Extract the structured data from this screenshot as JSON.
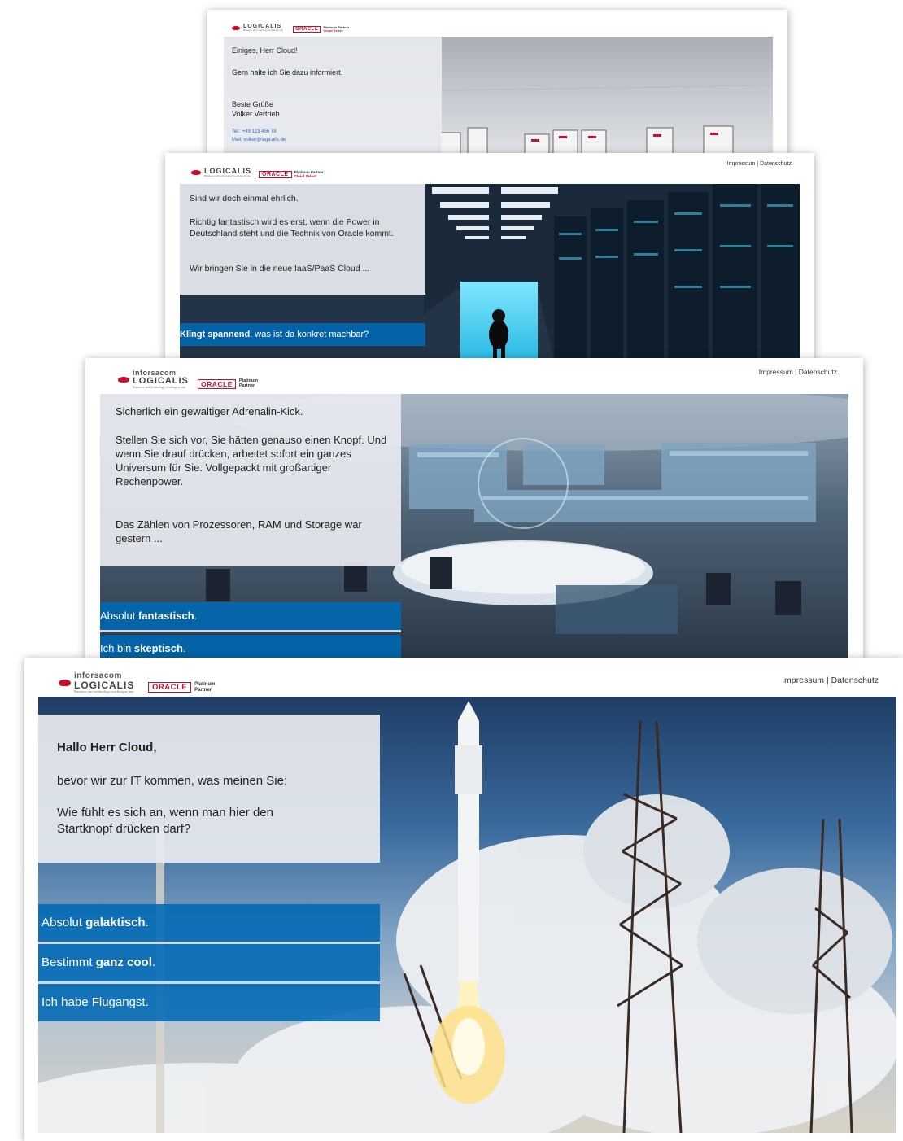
{
  "brand": {
    "company_top": "inforsacom",
    "company_main": "LOGICALIS",
    "tagline": "Business and technology working as one",
    "partner_logo": "ORACLE",
    "partner_level_1": "Platinum Partner",
    "partner_level_2": "Cloud Select",
    "partner_level_short_1": "Platinum",
    "partner_level_short_2": "Partner"
  },
  "nav": {
    "impressum": "Impressum",
    "separator": "|",
    "datenschutz": "Datenschutz"
  },
  "screen1": {
    "greeting": "Einiges, Herr Cloud!",
    "line": "Gern halte ich Sie dazu informiert.",
    "closing": "Beste Grüße",
    "signature": "Volker Vertrieb",
    "tel": "Tel.: +49 123 456 78",
    "mail": "Mail: volker@logicalis.de"
  },
  "screen2": {
    "line1": "Sind wir doch einmal ehrlich.",
    "line2": "Richtig fantastisch wird es erst, wenn die Power in Deutschland steht und die Technik von Oracle kommt.",
    "line3": "Wir bringen Sie in die neue IaaS/PaaS Cloud ...",
    "answer_strong": "Klingt spannend",
    "answer_rest": ", was ist da konkret machbar?"
  },
  "screen3": {
    "line1": "Sicherlich ein gewaltiger Adrenalin-Kick.",
    "line2": "Stellen Sie sich vor, Sie hätten genauso einen Knopf. Und wenn Sie drauf drücken, arbeitet sofort ein ganzes Universum für Sie. Vollgepackt mit großartiger Rechenpower.",
    "line3": "Das Zählen von Prozessoren, RAM und Storage war gestern ...",
    "answer1_pre": "Absolut ",
    "answer1_strong": "fantastisch",
    "answer1_post": ".",
    "answer2_pre": "Ich bin ",
    "answer2_strong": "skeptisch",
    "answer2_post": "."
  },
  "screen4": {
    "heading": "Hallo Herr Cloud,",
    "line1": "bevor wir zur IT kommen, was meinen Sie:",
    "line2": "Wie fühlt es sich an, wenn man hier den Startknopf drücken darf?",
    "answer1_pre": "Absolut ",
    "answer1_strong": "galaktisch",
    "answer1_post": ".",
    "answer2_pre": "Bestimmt ",
    "answer2_strong": "ganz cool",
    "answer2_post": ".",
    "answer3": "Ich habe Flugangst."
  },
  "colors": {
    "accent_blue": "#0069b4",
    "oracle_red": "#c8102e",
    "panel": "#e8ebf0"
  }
}
